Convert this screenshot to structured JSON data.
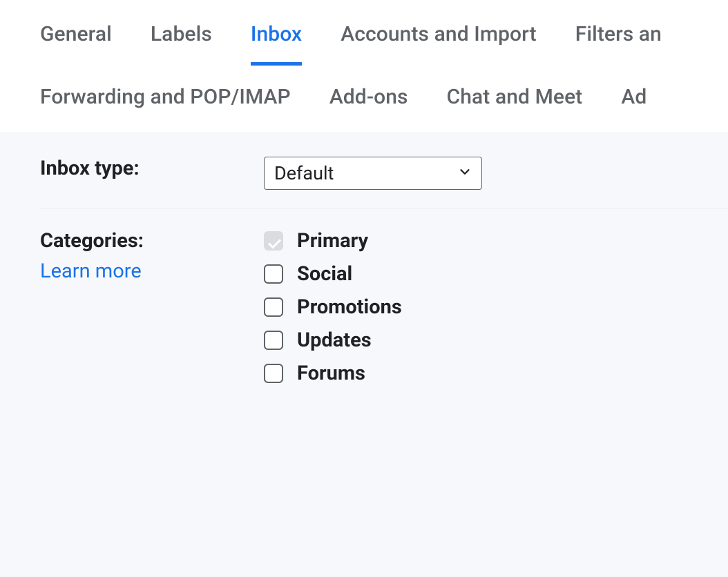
{
  "tabs": {
    "row1": [
      {
        "id": "general",
        "label": "General",
        "active": false
      },
      {
        "id": "labels",
        "label": "Labels",
        "active": false
      },
      {
        "id": "inbox",
        "label": "Inbox",
        "active": true
      },
      {
        "id": "accounts",
        "label": "Accounts and Import",
        "active": false
      },
      {
        "id": "filters",
        "label": "Filters an",
        "active": false
      }
    ],
    "row2": [
      {
        "id": "forwarding",
        "label": "Forwarding and POP/IMAP",
        "active": false
      },
      {
        "id": "addons",
        "label": "Add-ons",
        "active": false
      },
      {
        "id": "chat",
        "label": "Chat and Meet",
        "active": false
      },
      {
        "id": "advanced",
        "label": "Ad",
        "active": false
      }
    ]
  },
  "inbox_type": {
    "label": "Inbox type:",
    "selected": "Default"
  },
  "categories": {
    "label": "Categories:",
    "learn_more": "Learn more",
    "items": [
      {
        "id": "primary",
        "label": "Primary",
        "checked": true,
        "disabled": true
      },
      {
        "id": "social",
        "label": "Social",
        "checked": false,
        "disabled": false
      },
      {
        "id": "promotions",
        "label": "Promotions",
        "checked": false,
        "disabled": false
      },
      {
        "id": "updates",
        "label": "Updates",
        "checked": false,
        "disabled": false
      },
      {
        "id": "forums",
        "label": "Forums",
        "checked": false,
        "disabled": false
      }
    ]
  }
}
